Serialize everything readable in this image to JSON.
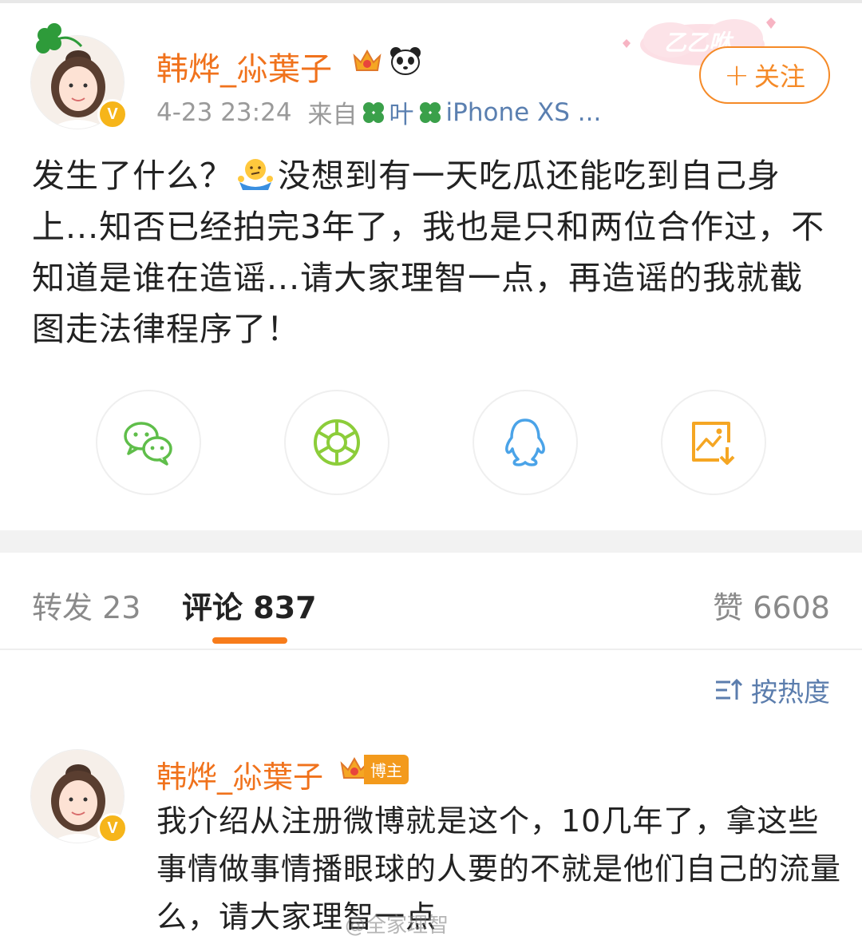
{
  "post": {
    "user_name": "韩烨_尛葉子",
    "time": "4-23 23:24",
    "source_prefix": "来自",
    "source": "叶",
    "device": "iPhone XS ...",
    "follow_label": "关注",
    "deco_text": "乙乙咻",
    "content_part1": "发生了什么？",
    "content_part2": "没想到有一天吃瓜还能吃到自己身上...知否已经拍完3年了，我也是只和两位合作过，不知道是谁在造谣...请大家理智一点，再造谣的我就截图走法律程序了！",
    "verified_mark": "V"
  },
  "share": {
    "icons": [
      "wechat-icon",
      "moments-icon",
      "qq-icon",
      "save-image-icon"
    ],
    "colors": {
      "wechat": "#5fbe4a",
      "moments": "#8ccd3a",
      "qq": "#4aa3e8",
      "save": "#f5a623"
    }
  },
  "tabs": {
    "repost_label": "转发",
    "repost_count": "23",
    "comment_label": "评论",
    "comment_count": "837",
    "like_label": "赞",
    "like_count": "6608"
  },
  "sort": {
    "label": "按热度"
  },
  "comment": {
    "user_name": "韩烨_尛葉子",
    "badge": "博主",
    "text": "我介绍从注册微博就是这个，10几年了，拿这些事情做事情播眼球的人要的不就是他们自己的流量么，请大家理智一点"
  },
  "watermark": "@全家理智",
  "colors": {
    "accent": "#f0721c",
    "link": "#5b7dad",
    "indicator": "#f77c1b"
  }
}
